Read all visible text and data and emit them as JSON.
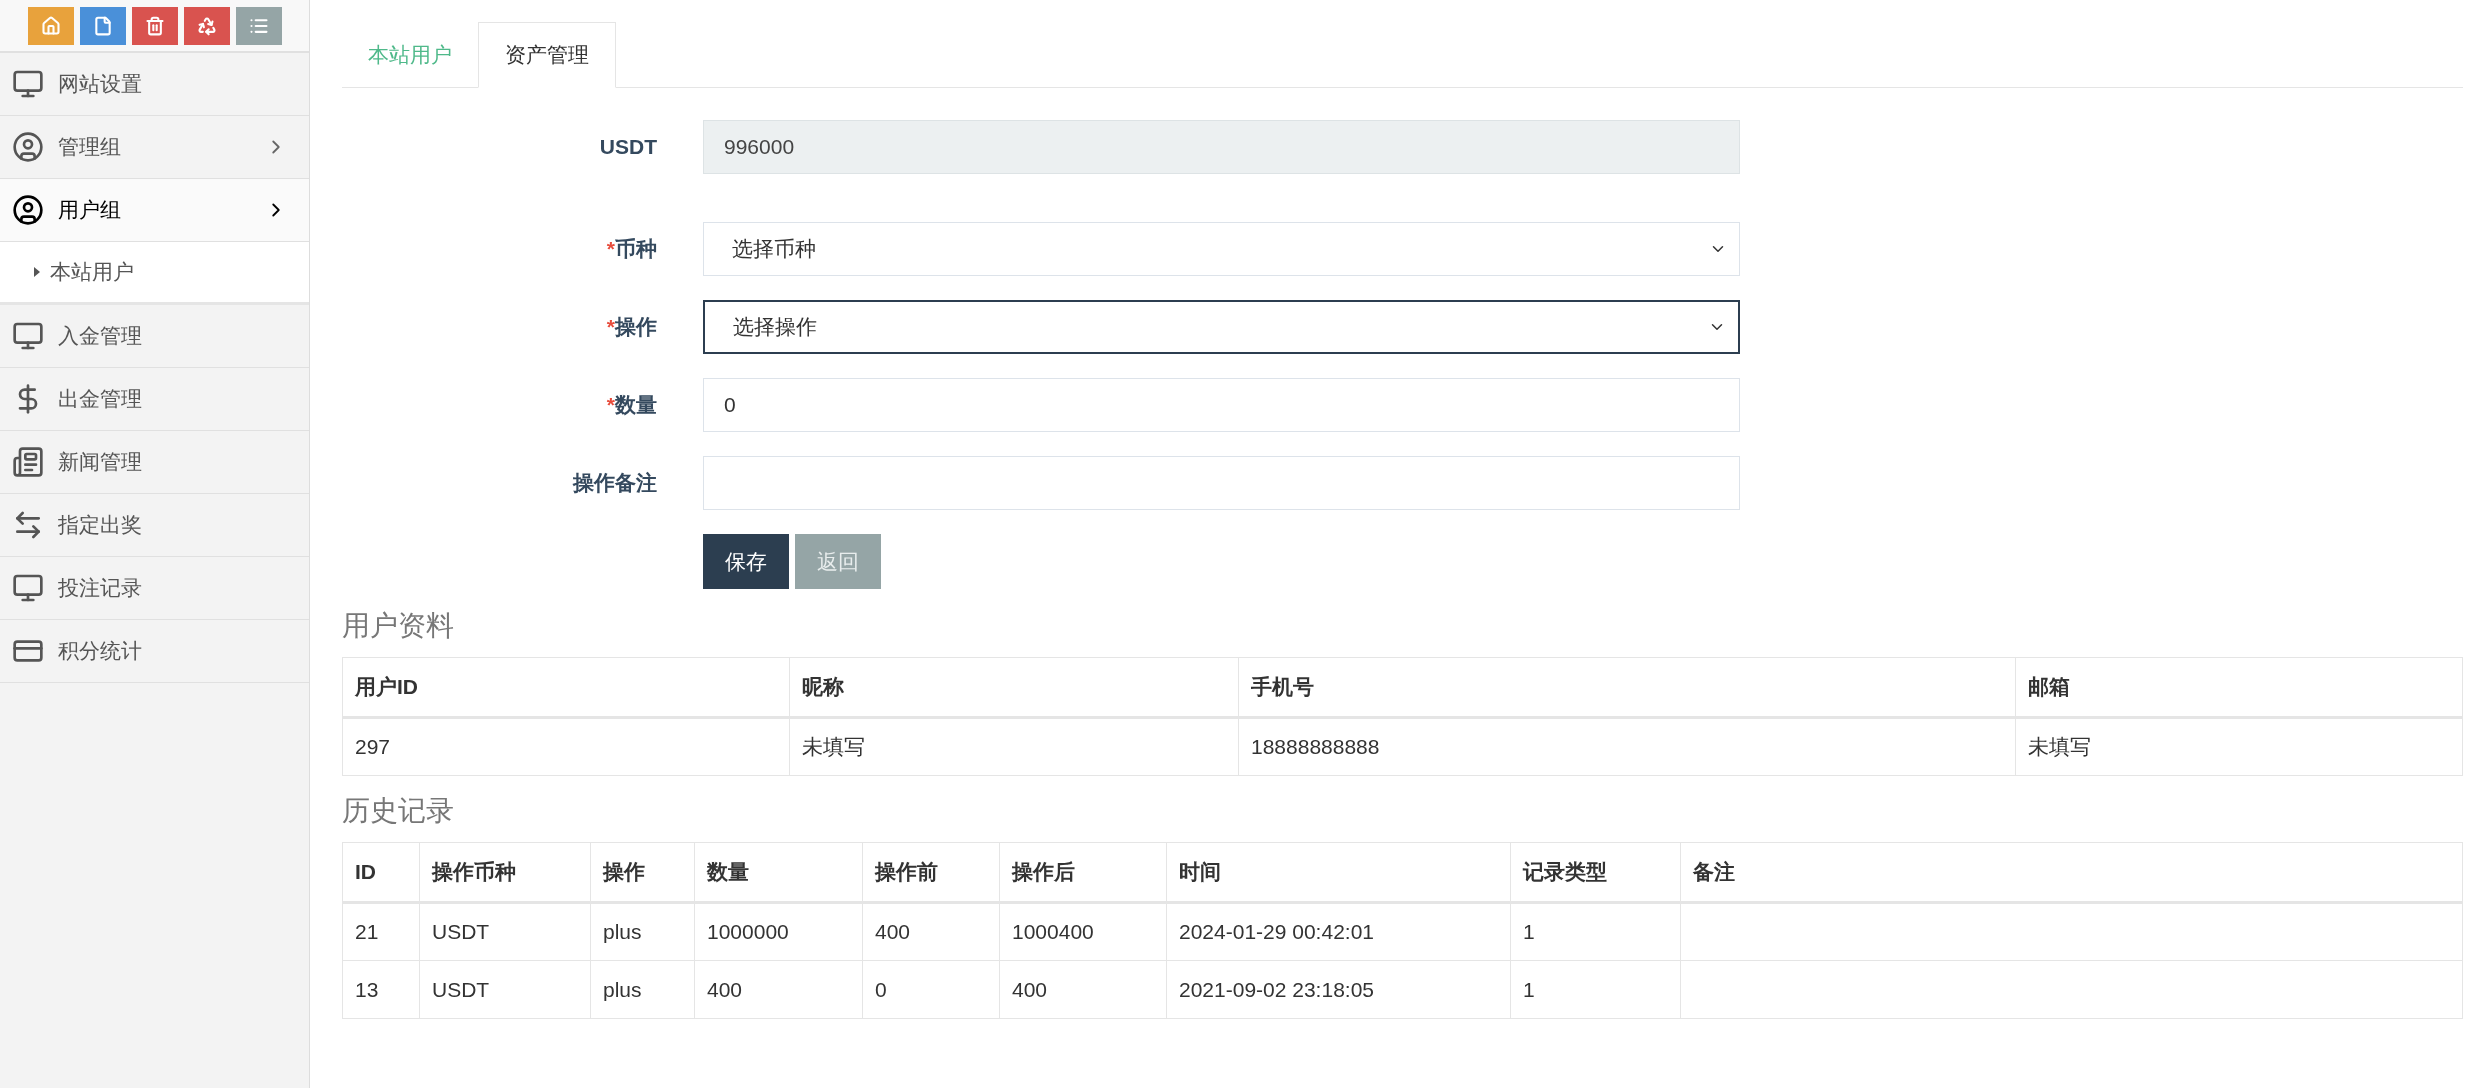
{
  "toolbar": [
    {
      "kind": "home",
      "color": "#e8a23c"
    },
    {
      "kind": "file",
      "color": "#4a90d9"
    },
    {
      "kind": "trash",
      "color": "#d9534f"
    },
    {
      "kind": "recycle",
      "color": "#d9534f"
    },
    {
      "kind": "list",
      "color": "#95a5a6"
    }
  ],
  "sidebar": {
    "items": [
      {
        "label": "网站设置",
        "kind": "link",
        "selected": false
      },
      {
        "label": "管理组",
        "kind": "group",
        "selected": false,
        "expanded": false
      },
      {
        "label": "用户组",
        "kind": "group",
        "selected": true,
        "expanded": true,
        "children": [
          {
            "label": "本站用户",
            "selected": false
          }
        ]
      },
      {
        "label": "入金管理",
        "kind": "link",
        "selected": false
      },
      {
        "label": "出金管理",
        "kind": "link",
        "selected": false
      },
      {
        "label": "新闻管理",
        "kind": "link",
        "selected": false
      },
      {
        "label": "指定出奖",
        "kind": "link",
        "selected": false
      },
      {
        "label": "投注记录",
        "kind": "link",
        "selected": false
      },
      {
        "label": "积分统计",
        "kind": "link",
        "selected": false
      }
    ]
  },
  "tabs": [
    {
      "label": "本站用户",
      "selected": false
    },
    {
      "label": "资产管理",
      "selected": true
    }
  ],
  "form": {
    "balance": {
      "label": "USDT",
      "value": "996000"
    },
    "fields": [
      {
        "mark": "*",
        "label": "币种",
        "kind": "select",
        "value": "选择币种",
        "focused": false
      },
      {
        "mark": "*",
        "label": "操作",
        "kind": "select",
        "value": "选择操作",
        "focused": true
      },
      {
        "mark": "*",
        "label": "数量",
        "kind": "input",
        "value": "0",
        "focused": false
      },
      {
        "label": "操作备注",
        "kind": "input",
        "focused": false
      }
    ],
    "buttons": [
      {
        "label": "保存",
        "kind": "primary"
      },
      {
        "label": "返回",
        "kind": "secondary"
      }
    ]
  },
  "user_profile": {
    "title": "用户资料",
    "columns": [
      "用户ID",
      "昵称",
      "手机号",
      "邮箱"
    ],
    "rows": [
      [
        "297",
        "未填写",
        "18888888888",
        "未填写"
      ]
    ]
  },
  "history": {
    "title": "历史记录",
    "columns": [
      "ID",
      "操作币种",
      "操作",
      "数量",
      "操作前",
      "操作后",
      "时间",
      "记录类型",
      "备注"
    ],
    "rows": [
      [
        "21",
        "USDT",
        "plus",
        "1000000",
        "400",
        "1000400",
        "2024-01-29 00:42:01",
        "1"
      ],
      [
        "13",
        "USDT",
        "plus",
        "400",
        "0",
        "400",
        "2021-09-02 23:18:05",
        "1"
      ]
    ]
  }
}
